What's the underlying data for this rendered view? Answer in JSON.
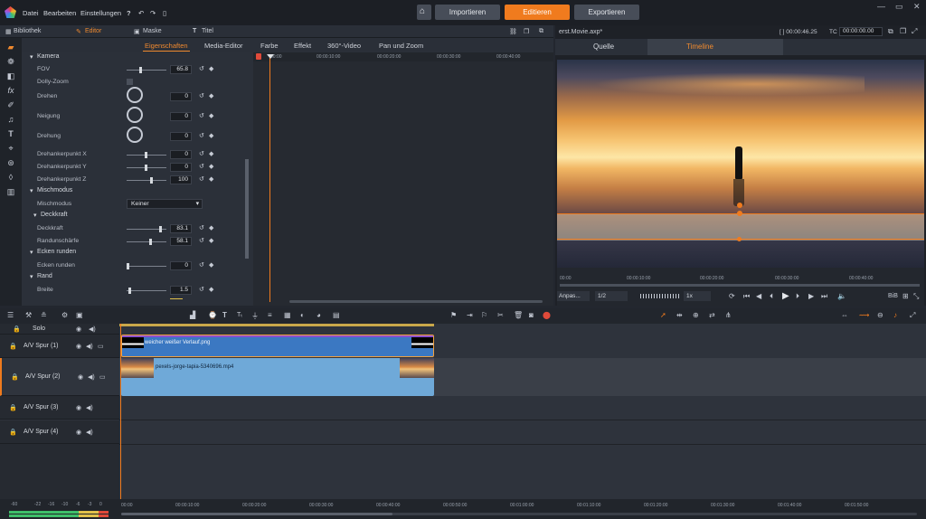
{
  "menu": {
    "items": [
      "Datei",
      "Bearbeiten",
      "Einstellungen"
    ]
  },
  "nav": {
    "import": "Importieren",
    "edit": "Editieren",
    "export": "Exportieren"
  },
  "lefttabs": {
    "library": "Bibliothek",
    "editor": "Editor",
    "mask": "Maske",
    "title": "Titel"
  },
  "subtabs": [
    "Eigenschaften",
    "Media-Editor",
    "Farbe",
    "Effekt",
    "360°-Video",
    "Pan und Zoom"
  ],
  "props": {
    "camera": "Kamera",
    "fov": "FOV",
    "fov_val": "65.8",
    "dolly": "Dolly-Zoom",
    "rotate": "Drehen",
    "rotate_val": "0",
    "tilt": "Neigung",
    "tilt_val": "0",
    "spin": "Drehung",
    "spin_val": "0",
    "ax": "Drehankerpunkt X",
    "ax_val": "0",
    "ay": "Drehankerpunkt Y",
    "ay_val": "0",
    "az": "Drehankerpunkt Z",
    "az_val": "100",
    "blend_sec": "Mischmodus",
    "blend": "Mischmodus",
    "blend_val": "Keiner",
    "opacity_sec": "Deckkraft",
    "opacity": "Deckkraft",
    "opacity_val": "83.1",
    "edge": "Randunschärfe",
    "edge_val": "58.1",
    "corners_sec": "Ecken runden",
    "corners": "Ecken runden",
    "corners_val": "0",
    "border_sec": "Rand",
    "width": "Breite",
    "width_val": "1.5"
  },
  "kfticks": [
    "00:00",
    "00:00:10:00",
    "00:00:20:00",
    "00:00:30:00",
    "00:00:40:00"
  ],
  "preview": {
    "filename": "erst.Movie.axp*",
    "timecode": "[ ] 00:00:46.25",
    "tc_label": "TC",
    "tc_val": "00:00:00.00",
    "source": "Quelle",
    "timeline": "Timeline",
    "ticks": [
      "00:00",
      "00:00:10:00",
      "00:00:20:00",
      "00:00:30:00",
      "00:00:40:00"
    ],
    "fit": "Anpas...",
    "ratio": "1/2",
    "speed": "1x",
    "bib": "BiB"
  },
  "tracks": [
    {
      "name": "Solo"
    },
    {
      "name": "A/V Spur (1)",
      "clip": "weicher weißer Verlauf.png"
    },
    {
      "name": "A/V Spur (2)",
      "clip": "pexels-jorge-tapia-5340696.mp4"
    },
    {
      "name": "A/V Spur (3)"
    },
    {
      "name": "A/V Spur (4)"
    }
  ],
  "meter": [
    "-60",
    "-22",
    "-16",
    "-10",
    "-6",
    "-3",
    "0"
  ],
  "tlticks": [
    "00:00",
    "00:00:10:00",
    "00:00:20:00",
    "00:00:30:00",
    "00:00:40:00",
    "00:00:50:00",
    "00:01:00:00",
    "00:01:10:00",
    "00:01:20:00",
    "00:01:30:00",
    "00:01:40:00",
    "00:01:50:00"
  ],
  "colors": {
    "accent": "#f07b1e",
    "clip1": "#3b78c2",
    "clip2": "#6fa9d8"
  }
}
